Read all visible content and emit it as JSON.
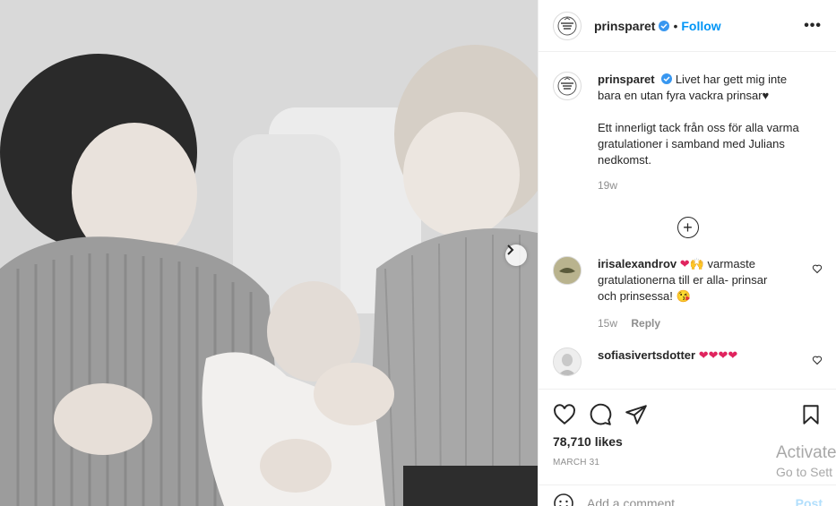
{
  "post": {
    "username": "prinsparet",
    "follow_label": "Follow",
    "more_label": "•••",
    "caption_line1": "Livet har gett mig inte bara en utan fyra vackra prinsar",
    "caption_heart": "♥",
    "caption_line2": "Ett innerligt tack från oss för alla varma gratulationer i samband med Julians nedkomst.",
    "caption_time": "19w",
    "load_more_label": "+"
  },
  "comments": [
    {
      "username": "irisalexandrov",
      "emoji_prefix": "❤🙌",
      "text": "varmaste gratulationerna till er alla- prinsar och prinsessa!",
      "emoji_suffix": "😘",
      "time": "15w",
      "reply_label": "Reply"
    },
    {
      "username": "sofiasivertsdotter",
      "emoji_prefix": "❤❤❤❤"
    }
  ],
  "stats": {
    "likes": "78,710 likes",
    "date": "MARCH 31"
  },
  "composer": {
    "placeholder": "Add a comment...",
    "post_label": "Post"
  },
  "watermark": {
    "line1": "Activate",
    "line2": "Go to Sett"
  },
  "icons": {
    "verified": "verified-badge-icon",
    "like": "heart-icon",
    "comment": "comment-bubble-icon",
    "share": "paper-plane-icon",
    "save": "bookmark-icon",
    "emoji": "smiley-icon",
    "next": "chevron-right-icon"
  },
  "colors": {
    "link": "#0095f6",
    "verified": "#3897f0",
    "heart": "#e0245e",
    "muted": "#8e8e8e"
  }
}
